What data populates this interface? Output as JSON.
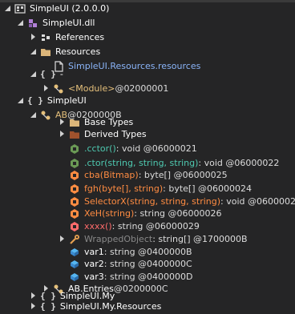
{
  "rows": [
    {
      "text": "SimpleUI (2.0.0.0)",
      "icon": "assembly-icon"
    },
    {
      "text": "SimpleUI.dll",
      "icon": "module-icon"
    },
    {
      "text": "References",
      "icon": "references-icon"
    },
    {
      "text": "Resources",
      "icon": "folder-icon"
    },
    {
      "text": "SimpleUI.Resources.resources",
      "icon": "resource-file-icon"
    },
    {
      "text": "-",
      "icon": "namespace-icon"
    },
    {
      "text": "<Module>",
      "suffix": " @02000001",
      "icon": "type-icon"
    },
    {
      "text": "SimpleUI",
      "icon": "namespace-icon"
    },
    {
      "text": "AB",
      "suffix": " @0200000B",
      "icon": "class-icon"
    },
    {
      "text": "Base Types",
      "icon": "folder-icon"
    },
    {
      "text": "Derived Types",
      "icon": "folder-red-icon"
    },
    {
      "text": ".cctor()",
      "suffix": " : void @06000021",
      "icon": "method-icon"
    },
    {
      "text": ".ctor(string, string, string)",
      "suffix": " : void @06000022",
      "icon": "method-icon"
    },
    {
      "text": "cba(Bitmap)",
      "suffix": " : byte[] @06000025",
      "icon": "method-icon"
    },
    {
      "text": "fgh(byte[], string)",
      "suffix": " : byte[] @06000024",
      "icon": "method-icon"
    },
    {
      "text": "SelectorX(string, string, string)",
      "suffix": " : void @06000023",
      "icon": "method-icon"
    },
    {
      "text": "XeH(string)",
      "suffix": " : string @06000026",
      "icon": "method-icon"
    },
    {
      "text": "xxxx()",
      "suffix": " : string @06000029",
      "icon": "method-icon"
    },
    {
      "text": "WrappedObject",
      "suffix": " : string[] @1700000B",
      "icon": "property-icon"
    },
    {
      "text": "var1",
      "suffix": " : string @0400000B",
      "icon": "field-icon"
    },
    {
      "text": "var2",
      "suffix": " : string @0400000C",
      "icon": "field-icon"
    },
    {
      "text": "var3",
      "suffix": " : string @0400000D",
      "icon": "field-icon"
    },
    {
      "text": "AB.Entries",
      "suffix": " @0200000C",
      "icon": "class-icon"
    },
    {
      "text": "SimpleUI.My",
      "icon": "namespace-icon"
    },
    {
      "text": "SimpleUI.My.Resources",
      "icon": "namespace-icon"
    }
  ],
  "colors": {
    "background": "#252526",
    "namespace": "#ffffff",
    "method_teal": "#4ec9b0",
    "method_orange": "#ff8c42",
    "method_red": "#ff6b6b",
    "property_gray": "#888888",
    "field": "#8ab4f8",
    "type_yellow": "#e5c07b"
  }
}
